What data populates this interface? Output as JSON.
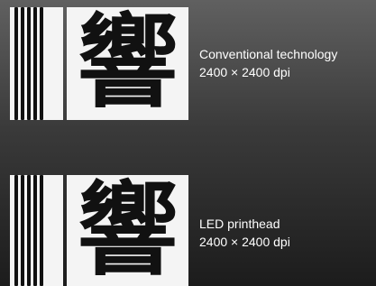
{
  "rows": [
    {
      "glyph": "響",
      "caption_line1": "Conventional technology",
      "caption_line2": "2400 × 2400 dpi"
    },
    {
      "glyph": "響",
      "caption_line1": "LED printhead",
      "caption_line2": "2400 × 2400 dpi"
    }
  ]
}
